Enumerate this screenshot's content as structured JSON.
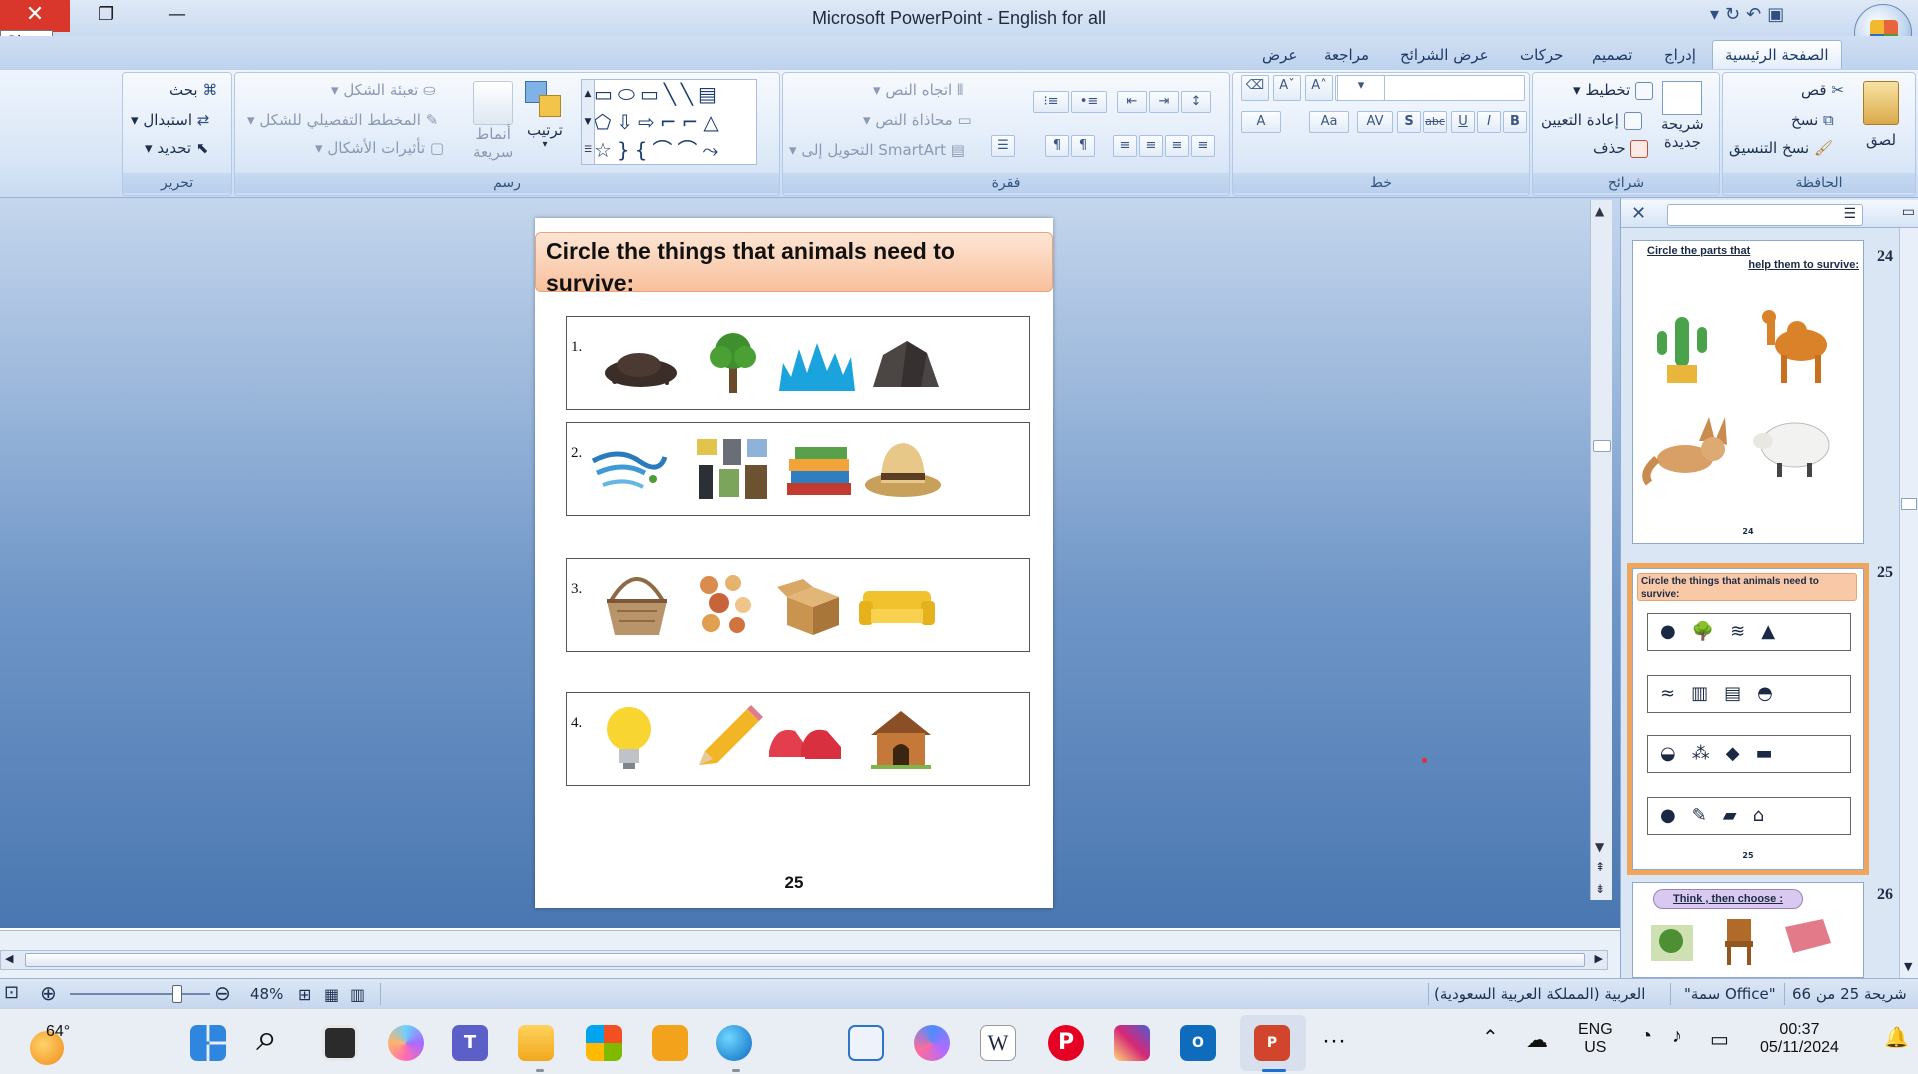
{
  "window": {
    "title": "Microsoft PowerPoint - English for all",
    "close_tooltip": "Close"
  },
  "tabs": [
    {
      "label": "الصفحة الرئيسية",
      "active": true
    },
    {
      "label": "إدراج"
    },
    {
      "label": "تصميم"
    },
    {
      "label": "حركات"
    },
    {
      "label": "عرض الشرائح"
    },
    {
      "label": "مراجعة"
    },
    {
      "label": "عرض"
    }
  ],
  "ribbon": {
    "clipboard": {
      "label": "الحافظة",
      "paste": "لصق",
      "cut": "قص",
      "copy": "نسخ",
      "format_painter": "نسخ التنسيق"
    },
    "slides": {
      "label": "شرائح",
      "new_slide_1": "شريحة",
      "new_slide_2": "جديدة",
      "layout": "تخطيط",
      "reset": "إعادة التعيين",
      "delete": "حذف"
    },
    "font": {
      "label": "خط",
      "bold": "B",
      "italic": "I",
      "underline": "U",
      "strike": "abc",
      "shadow": "S",
      "spacing": "AV",
      "case": "Aa",
      "color": "A"
    },
    "paragraph": {
      "label": "فقرة",
      "text_direction": "اتجاه النص",
      "align_text": "محاذاة النص",
      "smartart": "التحويل إلى SmartArt"
    },
    "drawing": {
      "label": "رسم",
      "arrange": "ترتيب",
      "quick_styles_1": "أنماط",
      "quick_styles_2": "سريعة",
      "shape_fill": "تعبئة الشكل",
      "shape_outline": "المخطط التفصيلي للشكل",
      "shape_effects": "تأثيرات الأشكال"
    },
    "editing": {
      "label": "تحرير",
      "find": "بحث",
      "replace": "استبدال",
      "select": "تحديد"
    }
  },
  "slide": {
    "title": "Circle the things that animals need to survive:",
    "questions": [
      {
        "number": "1.",
        "items": [
          "soil-icon",
          "tree-icon",
          "water-icon",
          "rock-icon"
        ]
      },
      {
        "number": "2.",
        "items": [
          "wind-icon",
          "clothes-icon",
          "books-icon",
          "hat-icon"
        ]
      },
      {
        "number": "3.",
        "items": [
          "basket-icon",
          "food-icon",
          "box-icon",
          "sofa-icon"
        ]
      },
      {
        "number": "4.",
        "items": [
          "lightbulb-icon",
          "pencil-icon",
          "shoes-icon",
          "doghouse-icon"
        ]
      }
    ],
    "page_number": "25"
  },
  "thumbnails": [
    {
      "number": "24",
      "title_line1": "Circle the parts that",
      "title_line2": "help them to survive:",
      "page": "24"
    },
    {
      "number": "25",
      "title": "Circle the things that animals need to survive:",
      "page": "25",
      "selected": true
    },
    {
      "number": "26",
      "title": "Think , then choose :"
    }
  ],
  "statusbar": {
    "slide_info": "شريحة 25 من 66",
    "theme": "\"سمة Office\"",
    "language": "العربية (المملكة العربية السعودية)",
    "zoom": "48%"
  },
  "taskbar": {
    "weather": "64°",
    "lang_1": "ENG",
    "lang_2": "US",
    "time": "00:37",
    "date": "05/11/2024",
    "more": "···"
  },
  "colors": {
    "ribbon_bg": "#d8e5f6",
    "workspace_top": "#c4d6ed",
    "workspace_bottom": "#4a77b1",
    "title_fill": "#f8c09c",
    "selected_outline": "#f0a55d"
  }
}
